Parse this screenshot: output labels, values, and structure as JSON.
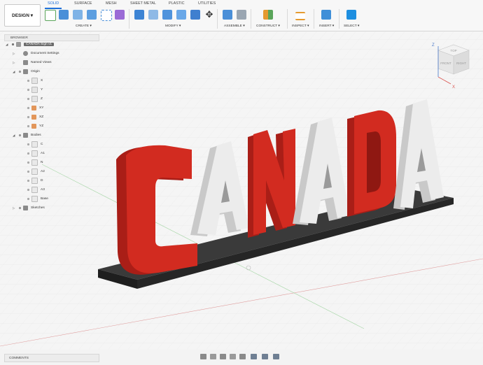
{
  "design_menu": {
    "label": "DESIGN ▾"
  },
  "tabs": [
    {
      "label": "SOLID",
      "active": true
    },
    {
      "label": "SURFACE"
    },
    {
      "label": "MESH"
    },
    {
      "label": "SHEET METAL"
    },
    {
      "label": "PLASTIC"
    },
    {
      "label": "UTILITIES"
    }
  ],
  "groups": {
    "create": "CREATE ▾",
    "modify": "MODIFY ▾",
    "assemble": "ASSEMBLE ▾",
    "construct": "CONSTRUCT ▾",
    "inspect": "INSPECT ▾",
    "insert": "INSERT ▾",
    "select": "SELECT ▾"
  },
  "browser": {
    "title": "BROWSER",
    "items": [
      {
        "label": "CANADA Sign v1",
        "selected": true
      },
      {
        "label": "Document Settings"
      },
      {
        "label": "Named Views"
      },
      {
        "label": "Origin"
      },
      {
        "label": "X"
      },
      {
        "label": "Y"
      },
      {
        "label": "Z"
      },
      {
        "label": "XY"
      },
      {
        "label": "XZ"
      },
      {
        "label": "YZ"
      },
      {
        "label": "Bodies"
      },
      {
        "label": "C"
      },
      {
        "label": "A1"
      },
      {
        "label": "N"
      },
      {
        "label": "A2"
      },
      {
        "label": "D"
      },
      {
        "label": "A3"
      },
      {
        "label": "Base"
      },
      {
        "label": "Sketches"
      }
    ]
  },
  "viewcube": {
    "top": "TOP",
    "front": "FRONT",
    "right": "RIGHT",
    "axis_x": "X",
    "axis_z": "Z"
  },
  "model": {
    "text": "CANADA",
    "red": "#d22b20",
    "white": "#ececec",
    "base": "#2a2a2a"
  },
  "comments": {
    "label": "COMMENTS"
  }
}
